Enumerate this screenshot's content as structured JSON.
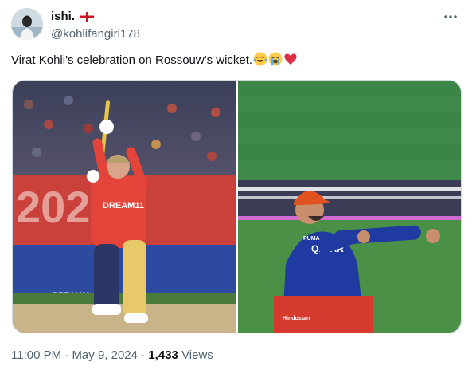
{
  "author": {
    "display_name": "ishi.",
    "handle": "@kohlifangirl178",
    "flag_icon": "england-flag-icon"
  },
  "tweet": {
    "text": "Virat Kohli's celebration on Rossouw's wicket.",
    "emojis": [
      "face-with-tears-of-joy-icon",
      "loudly-crying-face-icon",
      "red-heart-icon"
    ]
  },
  "media": {
    "left": {
      "banner_text": "2024",
      "jersey_text": "DREAM11",
      "board_text": "DREAM11"
    },
    "right": {
      "jersey_text": "QATAR",
      "brand_text": "PUMA",
      "sponsor_text": "Hindustan"
    }
  },
  "meta": {
    "time": "11:00 PM",
    "separator": "·",
    "date": "May 9, 2024",
    "views_count": "1,433",
    "views_label": "Views"
  },
  "colors": {
    "text_primary": "#0f1419",
    "text_secondary": "#536471",
    "border": "#cfd9de",
    "heart": "#e0245e"
  }
}
